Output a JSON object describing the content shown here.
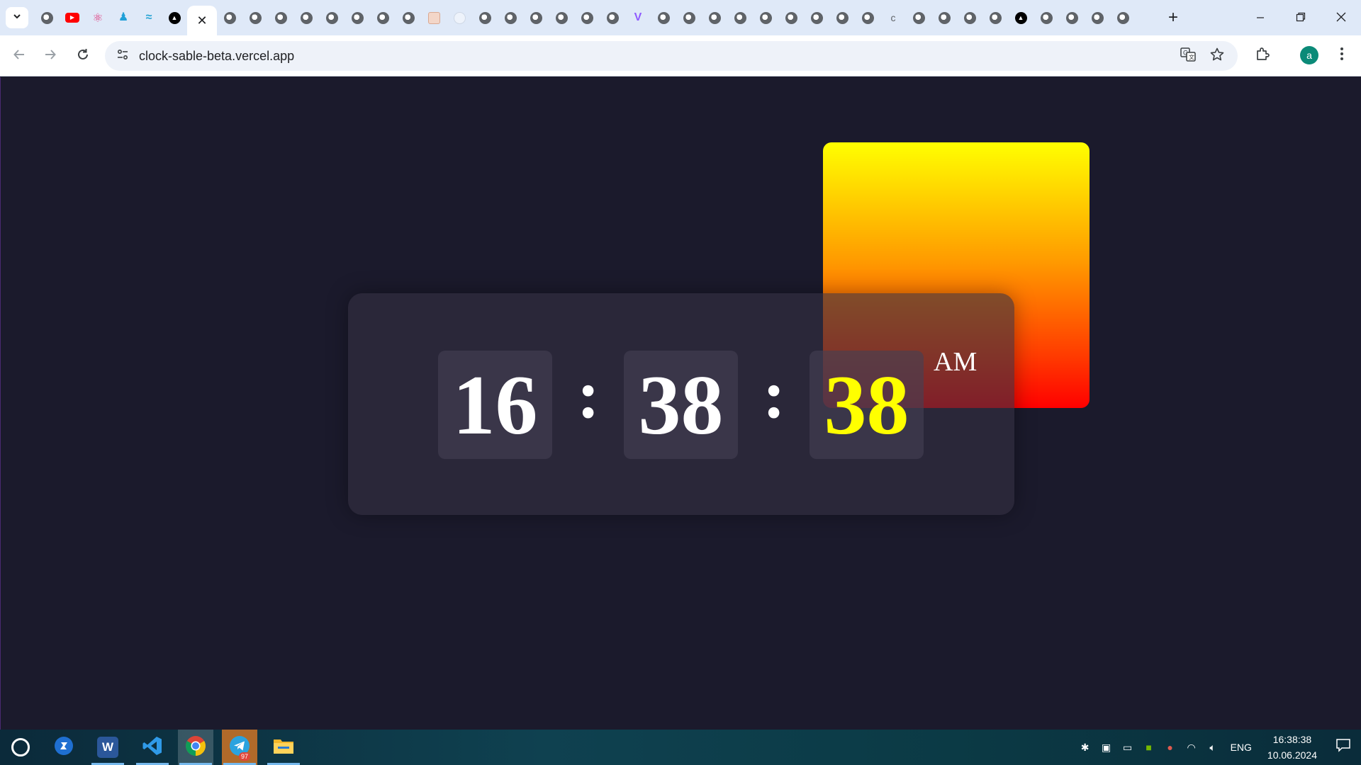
{
  "browser": {
    "tabs": [
      {
        "icon": "globe-icon",
        "kind": "globe"
      },
      {
        "icon": "youtube-icon",
        "kind": "yt"
      },
      {
        "icon": "react-icon",
        "kind": "react"
      },
      {
        "icon": "person-icon",
        "kind": "person"
      },
      {
        "icon": "tailwind-icon",
        "kind": "wave"
      },
      {
        "icon": "vercel-icon",
        "kind": "vercel"
      },
      {
        "icon": "close-icon",
        "kind": "active"
      },
      {
        "icon": "globe-icon",
        "kind": "globe"
      },
      {
        "icon": "globe-icon",
        "kind": "globe"
      },
      {
        "icon": "globe-icon",
        "kind": "globe"
      },
      {
        "icon": "globe-icon",
        "kind": "globe"
      },
      {
        "icon": "globe-icon",
        "kind": "globe"
      },
      {
        "icon": "globe-icon",
        "kind": "globe"
      },
      {
        "icon": "globe-icon",
        "kind": "globe"
      },
      {
        "icon": "globe-icon",
        "kind": "globe"
      },
      {
        "icon": "image-icon",
        "kind": "img"
      },
      {
        "icon": "speed-dial-icon",
        "kind": "dial"
      },
      {
        "icon": "globe-icon",
        "kind": "globe"
      },
      {
        "icon": "globe-icon",
        "kind": "globe"
      },
      {
        "icon": "globe-icon",
        "kind": "globe"
      },
      {
        "icon": "globe-icon",
        "kind": "globe"
      },
      {
        "icon": "globe-icon",
        "kind": "globe"
      },
      {
        "icon": "globe-icon",
        "kind": "globe"
      },
      {
        "icon": "vite-icon",
        "kind": "vite"
      },
      {
        "icon": "globe-icon",
        "kind": "globe"
      },
      {
        "icon": "globe-icon",
        "kind": "globe"
      },
      {
        "icon": "globe-icon",
        "kind": "globe"
      },
      {
        "icon": "globe-icon",
        "kind": "globe"
      },
      {
        "icon": "globe-icon",
        "kind": "globe"
      },
      {
        "icon": "globe-icon",
        "kind": "globe"
      },
      {
        "icon": "globe-icon",
        "kind": "globe"
      },
      {
        "icon": "globe-icon",
        "kind": "globe"
      },
      {
        "icon": "globe-icon",
        "kind": "globe"
      },
      {
        "icon": "loading-icon",
        "kind": "c"
      },
      {
        "icon": "globe-icon",
        "kind": "globe"
      },
      {
        "icon": "globe-icon",
        "kind": "globe"
      },
      {
        "icon": "globe-icon",
        "kind": "globe"
      },
      {
        "icon": "globe-icon",
        "kind": "globe"
      },
      {
        "icon": "vercel-icon",
        "kind": "vercel"
      },
      {
        "icon": "globe-icon",
        "kind": "globe"
      },
      {
        "icon": "globe-icon",
        "kind": "globe"
      },
      {
        "icon": "globe-icon",
        "kind": "globe"
      },
      {
        "icon": "globe-icon",
        "kind": "globe"
      }
    ],
    "new_tab_label": "+",
    "url": "clock-sable-beta.vercel.app",
    "profile_initial": "a"
  },
  "clock": {
    "hours": "16",
    "minutes": "38",
    "seconds": "38",
    "separator": ":",
    "period": "AM"
  },
  "colors": {
    "page_background": "#1b1a2c",
    "seconds_digits": "#ffff00",
    "gradient_top": "#ffff00",
    "gradient_bottom": "#ff0000"
  },
  "taskbar": {
    "apps": [
      {
        "icon": "cortana-icon"
      },
      {
        "icon": "pin-app-icon"
      },
      {
        "icon": "word-icon"
      },
      {
        "icon": "vscode-icon"
      },
      {
        "icon": "chrome-icon"
      },
      {
        "icon": "telegram-icon",
        "badge": "97"
      },
      {
        "icon": "file-explorer-icon"
      }
    ],
    "language": "ENG",
    "time": "16:38:38",
    "date": "10.06.2024"
  }
}
